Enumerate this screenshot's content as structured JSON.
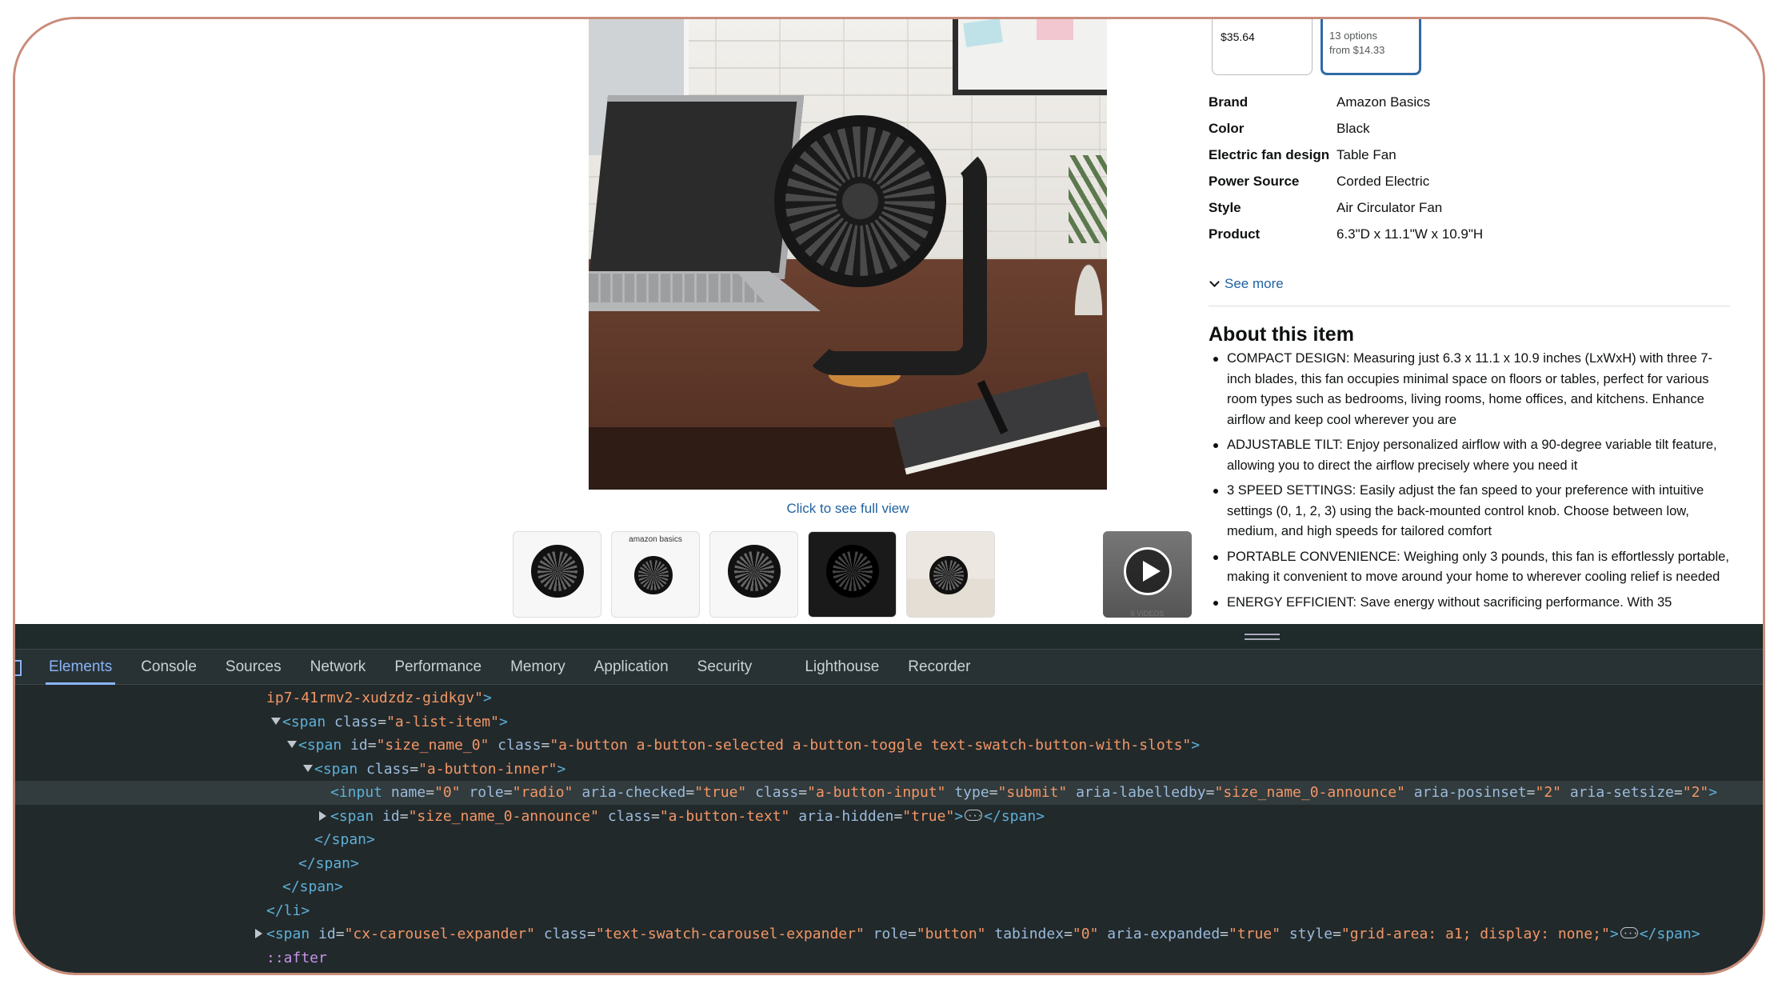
{
  "product": {
    "image_caption": "Click to see full view",
    "thumbnails": [
      {
        "name": "thumb-fan-front",
        "kind": "fan"
      },
      {
        "name": "thumb-amazon-basics-infographic",
        "kind": "brand",
        "text": "amazon basics"
      },
      {
        "name": "thumb-fan-angle",
        "kind": "fan"
      },
      {
        "name": "thumb-fan-closeup",
        "kind": "dark"
      },
      {
        "name": "thumb-fan-room",
        "kind": "room"
      },
      {
        "name": "thumb-fan-desk",
        "kind": "desk",
        "selected": true
      },
      {
        "name": "thumb-videos",
        "kind": "video",
        "text": "6 VIDEOS"
      }
    ],
    "options": [
      {
        "price": "$35.64"
      },
      {
        "line1": "13 options",
        "line2": "from $14.33"
      }
    ],
    "specs": [
      {
        "key": "Brand",
        "value": "Amazon Basics"
      },
      {
        "key": "Color",
        "value": "Black"
      },
      {
        "key": "Electric fan design",
        "value": "Table Fan"
      },
      {
        "key": "Power Source",
        "value": "Corded Electric"
      },
      {
        "key": "Style",
        "value": "Air Circulator Fan"
      },
      {
        "key": "Product",
        "value": "6.3\"D x 11.1\"W x 10.9\"H"
      }
    ],
    "see_more": "See more",
    "about_title": "About this item",
    "bullets": [
      "COMPACT DESIGN: Measuring just 6.3 x 11.1 x 10.9 inches (LxWxH) with three 7-inch blades, this fan occupies minimal space on floors or tables, perfect for various room types such as bedrooms, living rooms, home offices, and kitchens. Enhance airflow and keep cool wherever you are",
      "ADJUSTABLE TILT: Enjoy personalized airflow with a 90-degree variable tilt feature, allowing you to direct the airflow precisely where you need it",
      "3 SPEED SETTINGS: Easily adjust the fan speed to your preference with intuitive settings (0, 1, 2, 3) using the back-mounted control knob. Choose between low, medium, and high speeds for tailored comfort",
      "PORTABLE CONVENIENCE: Weighing only 3 pounds, this fan is effortlessly portable, making it convenient to move around your home to wherever cooling relief is needed",
      "ENERGY EFFICIENT: Save energy without sacrificing performance. With 35"
    ]
  },
  "devtools": {
    "tabs": [
      "Elements",
      "Console",
      "Sources",
      "Network",
      "Performance",
      "Memory",
      "Application",
      "Security",
      "Lighthouse",
      "Recorder"
    ],
    "active_tab": "Elements",
    "lines": [
      {
        "indent": 0,
        "tw": "none",
        "parts": [
          [
            "val",
            "ip7-41rmv2-xudzdz-gidkgv\""
          ],
          [
            "tag",
            ">"
          ]
        ]
      },
      {
        "indent": 1,
        "tw": "open",
        "parts": [
          [
            "tag",
            "<span "
          ],
          [
            "attr",
            "class"
          ],
          [
            "txt",
            "="
          ],
          [
            "val",
            "\"a-list-item\""
          ],
          [
            "tag",
            ">"
          ]
        ]
      },
      {
        "indent": 2,
        "tw": "open",
        "parts": [
          [
            "tag",
            "<span "
          ],
          [
            "attr",
            "id"
          ],
          [
            "txt",
            "="
          ],
          [
            "val",
            "\"size_name_0\" "
          ],
          [
            "attr",
            "class"
          ],
          [
            "txt",
            "="
          ],
          [
            "val",
            "\"a-button a-button-selected a-button-toggle text-swatch-button-with-slots\""
          ],
          [
            "tag",
            ">"
          ]
        ]
      },
      {
        "indent": 3,
        "tw": "open",
        "parts": [
          [
            "tag",
            "<span "
          ],
          [
            "attr",
            "class"
          ],
          [
            "txt",
            "="
          ],
          [
            "val",
            "\"a-button-inner\""
          ],
          [
            "tag",
            ">"
          ]
        ]
      },
      {
        "indent": 4,
        "tw": "none",
        "hl": true,
        "parts": [
          [
            "tag",
            "<input "
          ],
          [
            "attr",
            "name"
          ],
          [
            "txt",
            "="
          ],
          [
            "val",
            "\"0\" "
          ],
          [
            "attr",
            "role"
          ],
          [
            "txt",
            "="
          ],
          [
            "val",
            "\"radio\" "
          ],
          [
            "attr",
            "aria-checked"
          ],
          [
            "txt",
            "="
          ],
          [
            "val",
            "\"true\" "
          ],
          [
            "attr",
            "class"
          ],
          [
            "txt",
            "="
          ],
          [
            "val",
            "\"a-button-input\" "
          ],
          [
            "attr",
            "type"
          ],
          [
            "txt",
            "="
          ],
          [
            "val",
            "\"submit\" "
          ],
          [
            "attr",
            "aria-labelledby"
          ],
          [
            "txt",
            "="
          ],
          [
            "val",
            "\"size_name_0-announce\" "
          ],
          [
            "attr",
            "aria-posinset"
          ],
          [
            "txt",
            "="
          ],
          [
            "val",
            "\"2\" "
          ],
          [
            "attr",
            "aria-setsize"
          ],
          [
            "txt",
            "="
          ],
          [
            "val",
            "\"2\""
          ],
          [
            "tag",
            ">"
          ]
        ]
      },
      {
        "indent": 4,
        "tw": "closed",
        "parts": [
          [
            "tag",
            "<span "
          ],
          [
            "attr",
            "id"
          ],
          [
            "txt",
            "="
          ],
          [
            "val",
            "\"size_name_0-announce\" "
          ],
          [
            "attr",
            "class"
          ],
          [
            "txt",
            "="
          ],
          [
            "val",
            "\"a-button-text\" "
          ],
          [
            "attr",
            "aria-hidden"
          ],
          [
            "txt",
            "="
          ],
          [
            "val",
            "\"true\""
          ],
          [
            "tag",
            ">"
          ],
          [
            "ell",
            ""
          ],
          [
            "tag",
            "</span>"
          ]
        ]
      },
      {
        "indent": 3,
        "tw": "none",
        "parts": [
          [
            "tag",
            "</span>"
          ]
        ]
      },
      {
        "indent": 2,
        "tw": "none",
        "parts": [
          [
            "tag",
            "</span>"
          ]
        ]
      },
      {
        "indent": 1,
        "tw": "none",
        "parts": [
          [
            "tag",
            "</span>"
          ]
        ]
      },
      {
        "indent": 0,
        "tw": "none",
        "parts": [
          [
            "tag",
            "</li>"
          ]
        ]
      },
      {
        "indent": 0,
        "tw": "closed",
        "parts": [
          [
            "tag",
            "<span "
          ],
          [
            "attr",
            "id"
          ],
          [
            "txt",
            "="
          ],
          [
            "val",
            "\"cx-carousel-expander\" "
          ],
          [
            "attr",
            "class"
          ],
          [
            "txt",
            "="
          ],
          [
            "val",
            "\"text-swatch-carousel-expander\" "
          ],
          [
            "attr",
            "role"
          ],
          [
            "txt",
            "="
          ],
          [
            "val",
            "\"button\" "
          ],
          [
            "attr",
            "tabindex"
          ],
          [
            "txt",
            "="
          ],
          [
            "val",
            "\"0\" "
          ],
          [
            "attr",
            "aria-expanded"
          ],
          [
            "txt",
            "="
          ],
          [
            "val",
            "\"true\" "
          ],
          [
            "attr",
            "style"
          ],
          [
            "txt",
            "="
          ],
          [
            "val",
            "\"grid-area: a1; display: none;\""
          ],
          [
            "tag",
            ">"
          ],
          [
            "ell",
            ""
          ],
          [
            "tag",
            "</span>"
          ]
        ]
      },
      {
        "indent": 0,
        "tw": "none",
        "parts": [
          [
            "pseudo",
            "::after"
          ]
        ]
      }
    ]
  }
}
